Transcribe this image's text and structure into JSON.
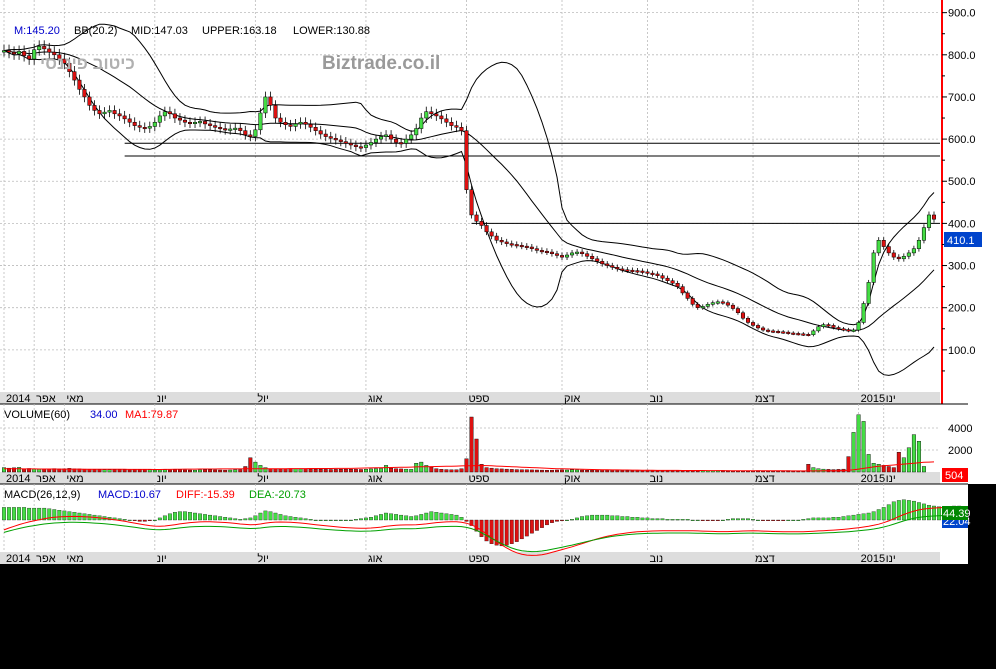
{
  "watermark": "Biztrade.co.il",
  "hebrew_watermark": "כיטוב פיננסי",
  "colors": {
    "up": "#44dd44",
    "down": "#dd1111",
    "band": "#000000",
    "price_axis": "#ff0000",
    "grid": "#bbbbbb",
    "blue": "#0000cc",
    "red": "#ff0000",
    "green": "#00a000",
    "axis_strip": "#dddddd"
  },
  "price_panel": {
    "legend": {
      "m": "M:145.20",
      "bb": "BB(20.2)",
      "mid": "MID:147.03",
      "upper": "UPPER:163.18",
      "lower": "LOWER:130.88"
    },
    "current_price": "410.1"
  },
  "volume_panel": {
    "legend": {
      "name": "VOLUME(60)",
      "value": "34.00",
      "ma": "MA1:79.87"
    },
    "current_badge": "504"
  },
  "macd_panel": {
    "legend": {
      "name": "MACD(26,12,9)",
      "macd": "MACD:10.67",
      "diff": "DIFF:-15.39",
      "dea": "DEA:-20.73"
    },
    "badge_top": "44.39",
    "badge_bottom": "22.04"
  },
  "x_axis_labels": [
    {
      "label": "2014",
      "index": 0
    },
    {
      "label": "אפר",
      "index": 6
    },
    {
      "label": "מאי",
      "index": 12
    },
    {
      "label": "יונ",
      "index": 30
    },
    {
      "label": "יול",
      "index": 50
    },
    {
      "label": "אוג",
      "index": 72
    },
    {
      "label": "ספט",
      "index": 92
    },
    {
      "label": "אוק",
      "index": 111
    },
    {
      "label": "נוב",
      "index": 128
    },
    {
      "label": "דצמ",
      "index": 149
    },
    {
      "label": "2015",
      "index": 170
    },
    {
      "label": "ינו",
      "index": 175
    }
  ],
  "chart_data": [
    {
      "type": "candlestick",
      "y_ticks": [
        100,
        200,
        300,
        400,
        500,
        600,
        700,
        800,
        900
      ],
      "y_tick_labels": [
        "100.0",
        "200.0",
        "300.0",
        "400.0",
        "500.0",
        "600.0",
        "700.0",
        "800.0",
        "900.0"
      ],
      "ylim": [
        0,
        930
      ],
      "horizontal_lines": [
        590,
        560,
        400
      ],
      "close": [
        810,
        806,
        802,
        808,
        798,
        790,
        812,
        820,
        814,
        806,
        800,
        790,
        780,
        760,
        740,
        718,
        700,
        680,
        668,
        660,
        664,
        668,
        660,
        655,
        648,
        640,
        632,
        628,
        626,
        630,
        640,
        655,
        665,
        660,
        650,
        645,
        640,
        638,
        640,
        642,
        636,
        632,
        628,
        625,
        622,
        624,
        626,
        620,
        610,
        606,
        622,
        662,
        700,
        680,
        650,
        640,
        634,
        630,
        636,
        640,
        635,
        628,
        620,
        612,
        606,
        602,
        598,
        594,
        590,
        586,
        582,
        580,
        586,
        592,
        600,
        606,
        610,
        600,
        592,
        590,
        600,
        610,
        625,
        650,
        665,
        660,
        655,
        648,
        640,
        632,
        628,
        620,
        480,
        420,
        405,
        395,
        380,
        370,
        360,
        356,
        352,
        350,
        348,
        346,
        344,
        340,
        336,
        334,
        332,
        328,
        324,
        320,
        325,
        330,
        332,
        328,
        322,
        316,
        310,
        304,
        300,
        296,
        292,
        290,
        289,
        288,
        287,
        285,
        282,
        280,
        276,
        270,
        264,
        258,
        250,
        235,
        222,
        208,
        200,
        203,
        208,
        212,
        214,
        212,
        206,
        198,
        188,
        175,
        165,
        158,
        152,
        147,
        145,
        144,
        143,
        142,
        140,
        139,
        138,
        137,
        136,
        145,
        155,
        160,
        158,
        153,
        150,
        148,
        146,
        147,
        165,
        210,
        260,
        330,
        360,
        345,
        330,
        320,
        316,
        322,
        330,
        340,
        360,
        390,
        420,
        410
      ],
      "volume": [
        400,
        350,
        380,
        420,
        300,
        320,
        300,
        280,
        260,
        300,
        310,
        280,
        300,
        330,
        290,
        280,
        260,
        240,
        230,
        220,
        210,
        200,
        210,
        220,
        200,
        190,
        200,
        210,
        220,
        200,
        180,
        190,
        200,
        190,
        210,
        200,
        190,
        180,
        170,
        190,
        200,
        210,
        190,
        180,
        170,
        180,
        200,
        220,
        500,
        1300,
        900,
        600,
        400,
        300,
        280,
        270,
        300,
        310,
        290,
        280,
        300,
        270,
        260,
        250,
        240,
        230,
        240,
        250,
        260,
        250,
        240,
        230,
        250,
        280,
        300,
        320,
        600,
        350,
        300,
        280,
        260,
        240,
        800,
        900,
        600,
        450,
        300,
        250,
        220,
        200,
        200,
        300,
        1200,
        5000,
        3000,
        700,
        400,
        350,
        300,
        280,
        260,
        240,
        220,
        210,
        200,
        190,
        180,
        170,
        160,
        170,
        180,
        190,
        180,
        200,
        190,
        180,
        160,
        170,
        180,
        190,
        170,
        160,
        150,
        140,
        130,
        140,
        150,
        160,
        170,
        160,
        150,
        140,
        130,
        120,
        130,
        140,
        150,
        140,
        130,
        120,
        110,
        120,
        130,
        140,
        130,
        120,
        110,
        100,
        110,
        120,
        130,
        120,
        110,
        100,
        110,
        120,
        130,
        120,
        110,
        100,
        700,
        400,
        300,
        260,
        240,
        220,
        240,
        260,
        1400,
        3600,
        5200,
        4600,
        1600,
        800,
        700,
        600,
        500,
        400,
        1800,
        1300,
        2200,
        3400,
        2800,
        504
      ],
      "volume_ma": [
        300,
        300,
        295,
        290,
        285,
        280,
        278,
        276,
        274,
        272,
        270,
        268,
        266,
        264,
        262,
        260,
        258,
        256,
        254,
        252,
        250,
        248,
        246,
        244,
        242,
        240,
        238,
        236,
        234,
        232,
        230,
        230,
        232,
        240,
        250,
        258,
        262,
        266,
        268,
        270,
        272,
        274,
        276,
        278,
        280,
        282,
        284,
        286,
        288,
        290,
        292,
        294,
        296,
        298,
        300,
        302,
        304,
        306,
        308,
        310,
        312,
        314,
        316,
        318,
        320,
        322,
        324,
        326,
        328,
        330,
        340,
        350,
        360,
        370,
        380,
        390,
        400,
        410,
        420,
        430,
        440,
        450,
        460,
        470,
        480,
        490,
        500,
        510,
        520,
        530,
        540,
        550,
        560,
        570,
        580,
        590,
        580,
        560,
        540,
        520,
        500,
        480,
        460,
        440,
        420,
        400,
        380,
        360,
        340,
        320,
        300,
        290,
        280,
        270,
        260,
        250,
        240,
        230,
        220,
        210,
        200,
        195,
        190,
        185,
        180,
        175,
        170,
        165,
        160,
        155,
        150,
        148,
        146,
        144,
        142,
        140,
        138,
        136,
        134,
        132,
        130,
        128,
        126,
        124,
        122,
        120,
        118,
        116,
        114,
        112,
        110,
        109,
        108,
        107,
        106,
        105,
        104,
        103,
        102,
        101,
        100,
        102,
        104,
        106,
        108,
        110,
        120,
        140,
        160,
        200,
        260,
        330,
        400,
        460,
        520,
        560,
        600,
        640,
        680,
        720,
        760,
        800,
        840,
        880,
        900,
        920
      ],
      "macd_hist": [
        18,
        18,
        18,
        18,
        18,
        17,
        17,
        17,
        17,
        16,
        15,
        14,
        13,
        12,
        11,
        10,
        9,
        8,
        7,
        6,
        5,
        4,
        3,
        2,
        1,
        0,
        -1,
        -2,
        -2,
        -1,
        0,
        3,
        6,
        9,
        11,
        12,
        12,
        11,
        10,
        9,
        8,
        7,
        6,
        5,
        4,
        3,
        2,
        1,
        2,
        3,
        6,
        10,
        13,
        12,
        10,
        8,
        6,
        5,
        4,
        3,
        2,
        1,
        0,
        0,
        0,
        0,
        0,
        0,
        0,
        0,
        1,
        2,
        3,
        4,
        6,
        8,
        10,
        9,
        8,
        7,
        6,
        5,
        6,
        8,
        10,
        12,
        11,
        10,
        9,
        8,
        7,
        4,
        -2,
        -8,
        -16,
        -24,
        -30,
        -34,
        -36,
        -37,
        -36,
        -34,
        -31,
        -27,
        -23,
        -19,
        -15,
        -11,
        -7,
        -4,
        -2,
        -1,
        0,
        1,
        3,
        5,
        6,
        7,
        7,
        7,
        7,
        6,
        6,
        5,
        5,
        4,
        4,
        3,
        3,
        2,
        2,
        2,
        1,
        1,
        1,
        1,
        1,
        0,
        0,
        -1,
        -1,
        -1,
        -1,
        0,
        1,
        2,
        2,
        2,
        2,
        1,
        0,
        -1,
        -1,
        -1,
        -1,
        -1,
        0,
        0,
        0,
        1,
        2,
        3,
        3,
        3,
        3,
        4,
        4,
        5,
        6,
        7,
        8,
        9,
        10,
        12,
        15,
        18,
        22,
        26,
        28,
        29,
        28,
        27,
        25,
        23,
        21,
        20,
        19,
        19,
        19,
        20,
        20
      ]
    }
  ]
}
